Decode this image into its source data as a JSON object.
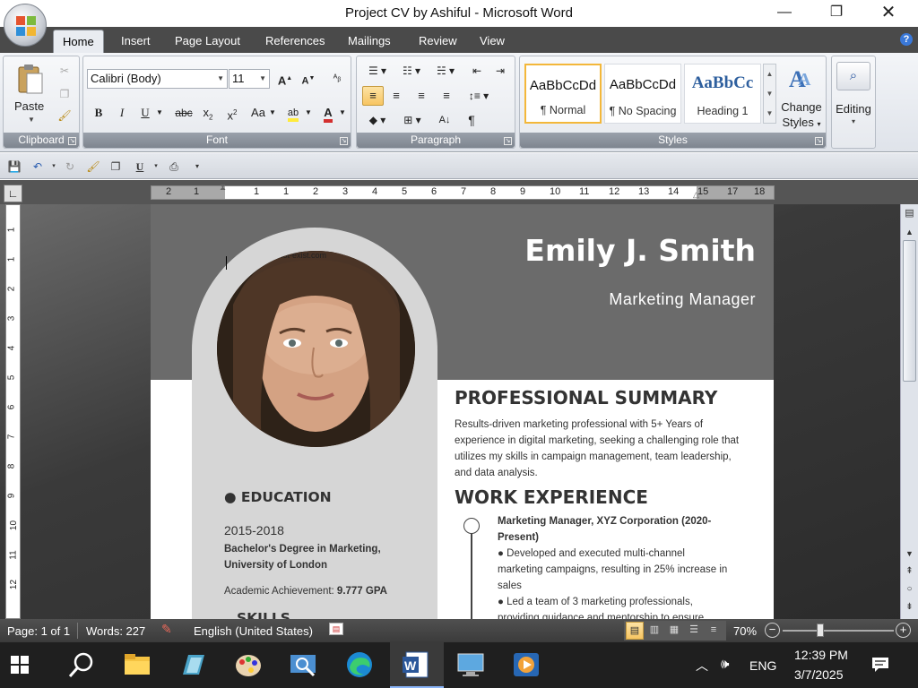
{
  "window": {
    "title": "Project CV by Ashiful",
    "app": "Microsoft Word",
    "full_title": "Project CV by Ashiful - Microsoft Word"
  },
  "tabs": [
    "Home",
    "Insert",
    "Page Layout",
    "References",
    "Mailings",
    "Review",
    "View"
  ],
  "active_tab": "Home",
  "ribbon": {
    "clipboard": {
      "label": "Clipboard",
      "paste": "Paste"
    },
    "font": {
      "label": "Font",
      "family": "Calibri (Body)",
      "size": "11"
    },
    "paragraph": {
      "label": "Paragraph"
    },
    "styles": {
      "label": "Styles",
      "items": [
        {
          "preview": "AaBbCcDd",
          "name": "¶ Normal"
        },
        {
          "preview": "AaBbCcDd",
          "name": "¶ No Spacing"
        },
        {
          "preview": "AaBbCc",
          "name": "Heading 1"
        }
      ],
      "change_styles": "Change Styles"
    },
    "editing": {
      "label": "Editing"
    }
  },
  "ruler": {
    "numbers": [
      "2",
      "1",
      "1",
      "1",
      "2",
      "3",
      "4",
      "5",
      "6",
      "7",
      "8",
      "9",
      "10",
      "11",
      "12",
      "13",
      "14",
      "15",
      "17",
      "18"
    ]
  },
  "vruler": [
    "1",
    "1",
    "2",
    "3",
    "4",
    "5",
    "6",
    "7",
    "8",
    "9",
    "10",
    "11",
    "12"
  ],
  "resume": {
    "name": "Emily J. Smith",
    "role": "Marketing Manager",
    "photo_watermark": "-s-not-exist.com",
    "summary_heading": "PROFESSIONAL SUMMARY",
    "summary_text": [
      "Results-driven marketing professional with 5+ Years of",
      "experience in digital marketing, seeking a challenging role that",
      "utilizes my skills in campaign management, team leadership,",
      "and data analysis."
    ],
    "work_heading": "WORK EXPERIENCE",
    "job_title": [
      "Marketing Manager, XYZ Corporation (2020-",
      "Present)"
    ],
    "bullets": [
      "● Developed and executed multi-channel",
      "marketing campaigns, resulting in 25% increase in",
      "sales",
      "● Led a team of 3 marketing professionals,",
      "providing guidance and mentorship to ensure"
    ],
    "education_heading": "● EDUCATION",
    "edu_years": "2015-2018",
    "degree": [
      "Bachelor's Degree in Marketing,",
      "University of London"
    ],
    "achievement_label": "Academic Achievement: ",
    "achievement_value": "9.777 GPA",
    "skills_heading": "SKILLS"
  },
  "status": {
    "page": "Page: 1 of 1",
    "words": "Words: 227",
    "language": "English (United States)",
    "zoom": "70%"
  },
  "taskbar": {
    "language": "ENG",
    "time": "12:39 PM",
    "date": "3/7/2025"
  },
  "colors": {
    "ribbon_bg": "#e6e9ee",
    "tabbar_bg": "#4a4a4a",
    "header_band": "#6b6b6b",
    "left_col": "#d6d6d6",
    "selection": "#f7c562"
  }
}
